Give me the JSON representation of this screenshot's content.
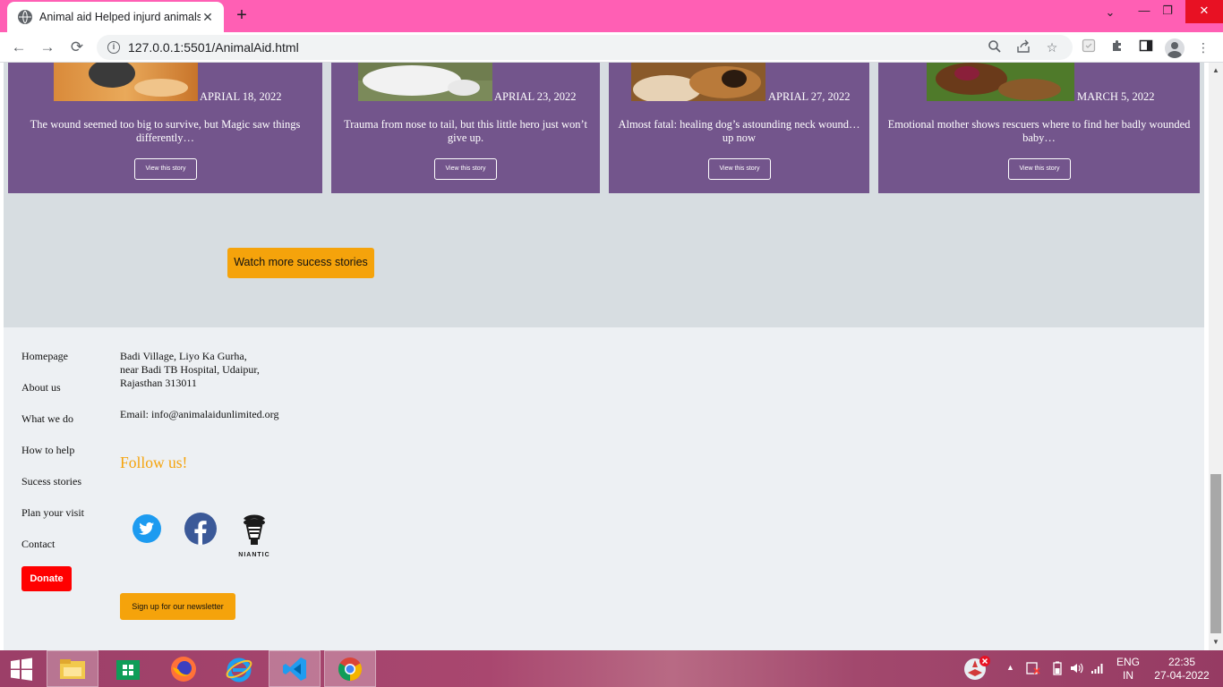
{
  "browser": {
    "tab_title": "Animal aid Helped injurd animals",
    "tab_close": "✕",
    "new_tab": "+",
    "url": "127.0.0.1:5501/AnimalAid.html",
    "window_controls": {
      "dropdown": "⌄",
      "minimize": "—",
      "restore": "❐",
      "close": "✕"
    }
  },
  "stories": {
    "cards": [
      {
        "date": "APRIAL 18, 2022",
        "text": "The wound seemed too big to survive, but Magic saw things differently…",
        "button": "View this story"
      },
      {
        "date": "APRIAL 23, 2022",
        "text": "Trauma from nose to tail, but this little hero just won’t give up.",
        "button": "View this story"
      },
      {
        "date": "APRIAL 27, 2022",
        "text": "Almost fatal: healing dog’s astounding neck wound…up now",
        "button": "View this story"
      },
      {
        "date": "MARCH 5, 2022",
        "text": "Emotional mother shows rescuers where to find her badly wounded baby…",
        "button": "View this story"
      }
    ],
    "more_button": "Watch more sucess stories"
  },
  "footer": {
    "links": [
      "Homepage",
      "About us",
      "What we do",
      "How to help",
      "Sucess stories",
      "Plan your visit",
      "Contact"
    ],
    "donate": "Donate",
    "address": [
      "Badi Village, Liyo Ka Gurha,",
      "near Badi TB Hospital, Udaipur,",
      "Rajasthan 313011"
    ],
    "email": "Email: info@animalaidunlimited.org",
    "follow": "Follow us!",
    "social": [
      "twitter-icon",
      "facebook-icon",
      "niantic-icon"
    ],
    "niantic_label": "NIANTIC",
    "newsletter": "Sign up for our newsletter"
  },
  "taskbar": {
    "apps": [
      "file-explorer",
      "store",
      "firefox",
      "internet-explorer",
      "vscode",
      "chrome"
    ],
    "lang": [
      "ENG",
      "IN"
    ],
    "time": "22:35",
    "date": "27-04-2022"
  },
  "colors": {
    "titlebar": "#ff5fb4",
    "card_purple": "#73558c",
    "accent_orange": "#f5a30b",
    "donate_red": "#ff0000",
    "band_gray": "#d7dde1",
    "footer_bg": "#edf0f3"
  }
}
